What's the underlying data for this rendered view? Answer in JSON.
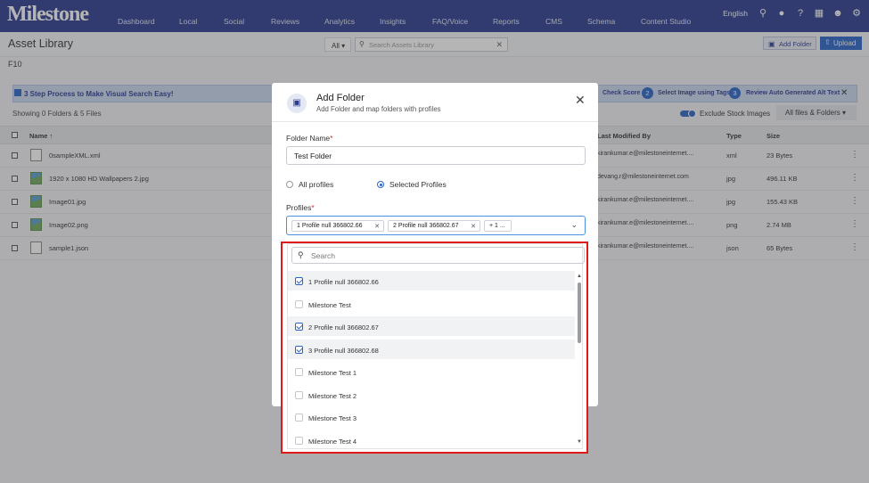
{
  "nav": {
    "logo": "Milestone",
    "items": [
      "Dashboard",
      "Local",
      "Social",
      "Reviews",
      "Analytics",
      "Insights",
      "FAQ/Voice",
      "Reports",
      "CMS",
      "Schema",
      "Content Studio"
    ],
    "language": "English"
  },
  "toolbar": {
    "title": "Asset Library",
    "filter_label": "All ▾",
    "search_placeholder": "Search Assets Library",
    "add_folder_label": "Add Folder",
    "upload_label": "Upload"
  },
  "breadcrumb": "F10",
  "banner": {
    "text": "3 Step Process to Make Visual Search Easy!",
    "step1": "Check Score",
    "step2_num": "2",
    "step2": "Select Image using Tags",
    "step3_num": "3",
    "step3": "Review Auto Generated Alt Text"
  },
  "summary": {
    "showing": "Showing 0 Folders & 5 Files",
    "exclude_label": "Exclude Stock Images",
    "filter_label": "All files & Folders ▾"
  },
  "table": {
    "headers": {
      "name": "Name ↑",
      "modified": "Last Modified By",
      "type": "Type",
      "size": "Size"
    },
    "rows": [
      {
        "name": "0sampleXML.xml",
        "modified": "kirankumar.e@milestoneinternet....",
        "type": "xml",
        "size": "23 Bytes"
      },
      {
        "name": "1920 x 1080 HD Wallpapers 2.jpg",
        "modified": "devang.r@milestoneinternet.com",
        "type": "jpg",
        "size": "496.11 KB"
      },
      {
        "name": "Image01.jpg",
        "modified": "kirankumar.e@milestoneinternet....",
        "type": "jpg",
        "size": "155.43 KB"
      },
      {
        "name": "Image02.png",
        "modified": "kirankumar.e@milestoneinternet....",
        "type": "png",
        "size": "2.74 MB"
      },
      {
        "name": "sample1.json",
        "modified": "kirankumar.e@milestoneinternet....",
        "type": "json",
        "size": "65 Bytes"
      }
    ]
  },
  "modal": {
    "title": "Add Folder",
    "subtitle": "Add Folder and map folders with profiles",
    "folder_name_label": "Folder Name",
    "folder_name_value": "Test Folder",
    "radio_all": "All profiles",
    "radio_selected": "Selected Profiles",
    "profiles_label": "Profiles",
    "chips": [
      "1 Profile null 366802.66",
      "2 Profile null 366802.67"
    ],
    "more_chip": "+ 1 ...",
    "dropdown_search_placeholder": "Search",
    "options": [
      {
        "label": "1 Profile null 366802.66",
        "checked": true
      },
      {
        "label": "Milestone Test",
        "checked": false
      },
      {
        "label": "2 Profile null 366802.67",
        "checked": true
      },
      {
        "label": "3 Profile null 366802.68",
        "checked": true
      },
      {
        "label": "Milestone Test 1",
        "checked": false
      },
      {
        "label": "Milestone Test 2",
        "checked": false
      },
      {
        "label": "Milestone Test 3",
        "checked": false
      },
      {
        "label": "Milestone Test 4",
        "checked": false
      }
    ]
  },
  "colors": {
    "nav": "#2b3b8f",
    "accent": "#2b64c7",
    "highlight": "#e01a1a"
  }
}
